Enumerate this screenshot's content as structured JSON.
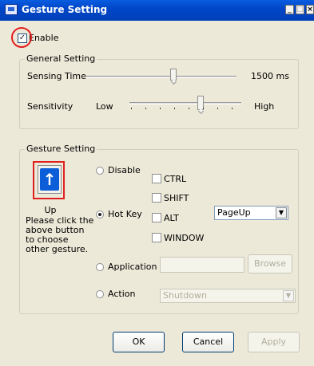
{
  "window": {
    "title": "Gesture Setting",
    "min_label": "_",
    "max_label": "□",
    "close_label": "×"
  },
  "enable": {
    "label": "Enable",
    "checked": true,
    "check_mark": "✓"
  },
  "general": {
    "group_label": "General Setting",
    "sensing_time": {
      "label": "Sensing Time",
      "value_text": "1500 ms"
    },
    "sensitivity": {
      "label": "Sensitivity",
      "low": "Low",
      "high": "High"
    }
  },
  "gesture": {
    "group_label": "Gesture Setting",
    "direction_label": "Up",
    "hint": [
      "Please click the",
      "above button",
      "to choose",
      "other gesture."
    ],
    "arrow_glyph": "↑",
    "options": {
      "disable": "Disable",
      "hotkey": "Hot Key",
      "application": "Application",
      "action": "Action"
    },
    "selected": "hotkey",
    "modifiers": {
      "ctrl": "CTRL",
      "shift": "SHIFT",
      "alt": "ALT",
      "window": "WINDOW"
    },
    "hotkey_value": "PageUp",
    "browse_label": "Browse",
    "action_value": "Shutdown",
    "dropdown_arrow": "▼"
  },
  "buttons": {
    "ok": "OK",
    "cancel": "Cancel",
    "apply": "Apply"
  },
  "colors": {
    "accent": "#0b5ed7",
    "highlight": "#e02020"
  }
}
